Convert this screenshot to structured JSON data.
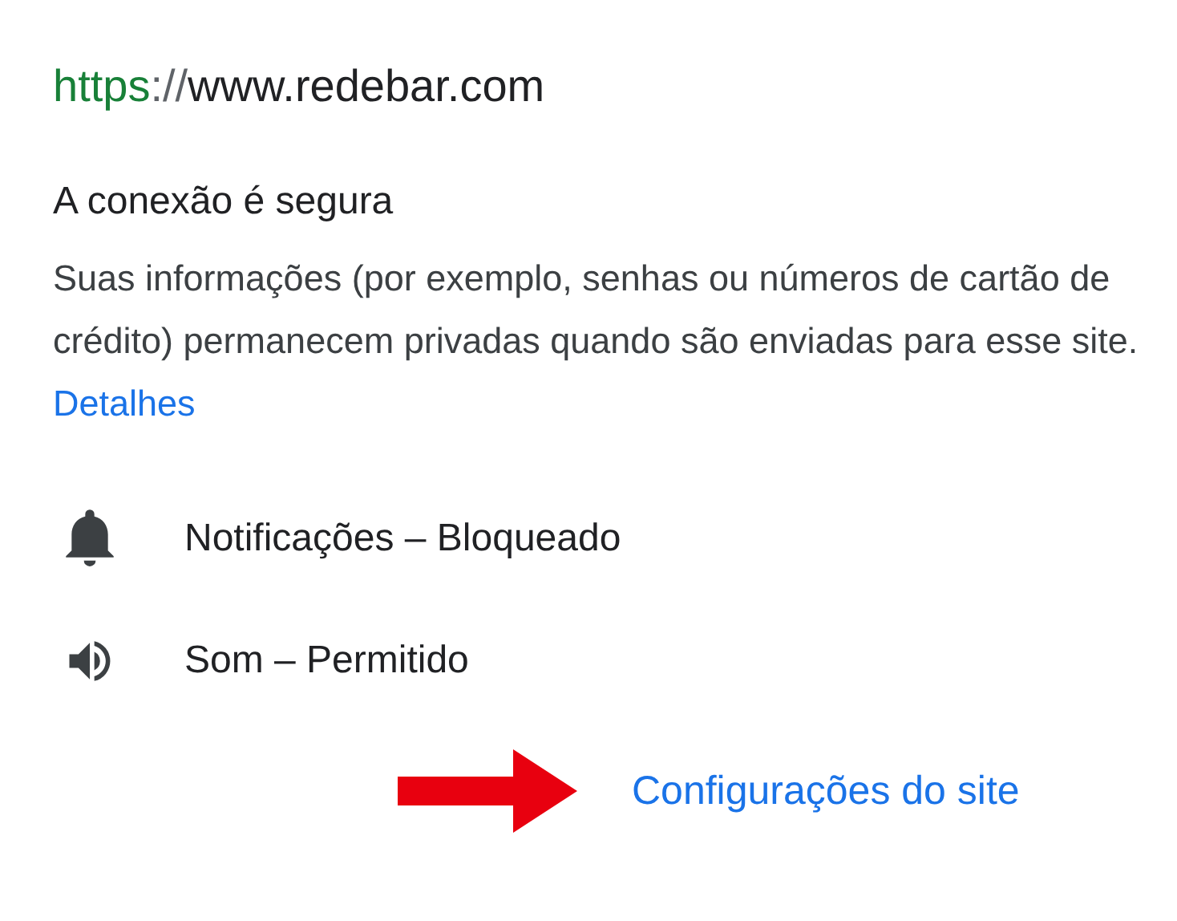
{
  "url": {
    "scheme": "https",
    "separator": "://",
    "host": "www.redebar.com"
  },
  "connection": {
    "title": "A conexão é segura",
    "description": "Suas informações (por exemplo, senhas ou números de cartão de crédito) permanecem privadas quando são enviadas para esse site.",
    "link": "Detalhes"
  },
  "permissions": [
    {
      "kind": "notifications",
      "label": "Notificações – Bloqueado"
    },
    {
      "kind": "sound",
      "label": "Som – Permitido"
    }
  ],
  "site_settings_link": "Configurações do site"
}
